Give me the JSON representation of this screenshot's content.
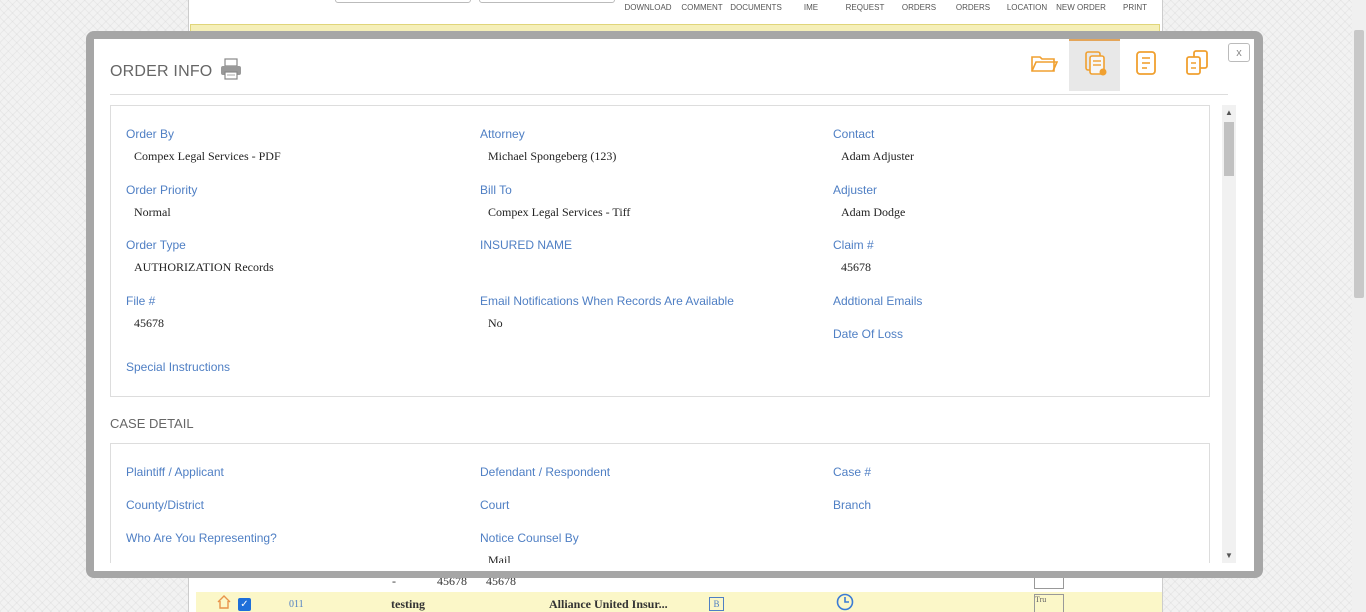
{
  "background": {
    "toolbar": [
      "DOWNLOAD",
      "COMMENT",
      "DOCUMENTS",
      "IME",
      "REQUEST",
      "ORDERS",
      "ORDERS",
      "LOCATION",
      "NEW ORDER",
      "PRINT"
    ],
    "row1": {
      "dash": "-",
      "val1": "45678",
      "val2": "45678"
    },
    "row2": {
      "id": "011",
      "name": "testing",
      "company": "Alliance United Insur...",
      "badge": "B",
      "summ1": "Summ",
      "summ2": "Tru"
    }
  },
  "modal": {
    "title": "ORDER INFO",
    "close_label": "x",
    "order": {
      "order_by": {
        "label": "Order By",
        "value": "Compex Legal Services - PDF"
      },
      "attorney": {
        "label": "Attorney",
        "value": "Michael Spongeberg (123)"
      },
      "contact": {
        "label": "Contact",
        "value": "Adam Adjuster"
      },
      "order_priority": {
        "label": "Order Priority",
        "value": "Normal"
      },
      "bill_to": {
        "label": "Bill To",
        "value": "Compex Legal Services - Tiff"
      },
      "adjuster": {
        "label": "Adjuster",
        "value": "Adam Dodge"
      },
      "order_type": {
        "label": "Order Type",
        "value": "AUTHORIZATION Records"
      },
      "insured_name": {
        "label": "INSURED NAME",
        "value": ""
      },
      "claim": {
        "label": "Claim #",
        "value": "45678"
      },
      "file": {
        "label": "File #",
        "value": "45678"
      },
      "email_notif": {
        "label": "Email Notifications When Records Are Available",
        "value": "No"
      },
      "additional_emails": {
        "label": "Addtional Emails"
      },
      "date_of_loss": {
        "label": "Date Of Loss"
      },
      "special_instructions": {
        "label": "Special Instructions"
      }
    },
    "case_detail": {
      "title": "CASE DETAIL",
      "plaintiff": {
        "label": "Plaintiff / Applicant"
      },
      "defendant": {
        "label": "Defendant / Respondent"
      },
      "case_no": {
        "label": "Case #"
      },
      "county": {
        "label": "County/District"
      },
      "court": {
        "label": "Court"
      },
      "branch": {
        "label": "Branch"
      },
      "representing": {
        "label": "Who Are You Representing?"
      },
      "notice_counsel": {
        "label": "Notice Counsel By",
        "value": "Mail"
      }
    },
    "colors": {
      "accent": "#f0a030",
      "label": "#4f7fc4"
    }
  }
}
